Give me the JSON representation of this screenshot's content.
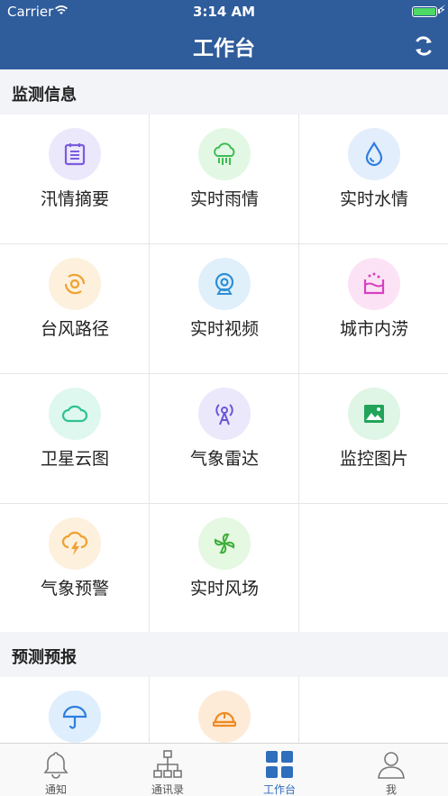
{
  "status": {
    "carrier": "Carrier",
    "time": "3:14 AM"
  },
  "nav": {
    "title": "工作台",
    "refresh_icon": "refresh-icon"
  },
  "sections": [
    {
      "title": "监测信息",
      "items": [
        {
          "label": "汛情摘要",
          "icon": "report-icon"
        },
        {
          "label": "实时雨情",
          "icon": "rain-cloud-icon"
        },
        {
          "label": "实时水情",
          "icon": "water-drop-icon"
        },
        {
          "label": "台风路径",
          "icon": "typhoon-icon"
        },
        {
          "label": "实时视频",
          "icon": "camera-icon"
        },
        {
          "label": "城市内涝",
          "icon": "flood-icon"
        },
        {
          "label": "卫星云图",
          "icon": "cloud-icon"
        },
        {
          "label": "气象雷达",
          "icon": "radar-icon"
        },
        {
          "label": "监控图片",
          "icon": "image-icon"
        },
        {
          "label": "气象预警",
          "icon": "storm-warning-icon"
        },
        {
          "label": "实时风场",
          "icon": "wind-fan-icon"
        }
      ]
    },
    {
      "title": "预测预报",
      "items": [
        {
          "label": "",
          "icon": "umbrella-icon"
        },
        {
          "label": "",
          "icon": "helmet-icon"
        }
      ]
    }
  ],
  "tabs": [
    {
      "label": "通知",
      "icon": "bell-icon"
    },
    {
      "label": "通讯录",
      "icon": "org-chart-icon"
    },
    {
      "label": "工作台",
      "icon": "grid-icon",
      "active": true
    },
    {
      "label": "我",
      "icon": "person-icon"
    }
  ],
  "colors": {
    "nav": "#2f5c9b",
    "active_tab": "#2f6dbd"
  }
}
